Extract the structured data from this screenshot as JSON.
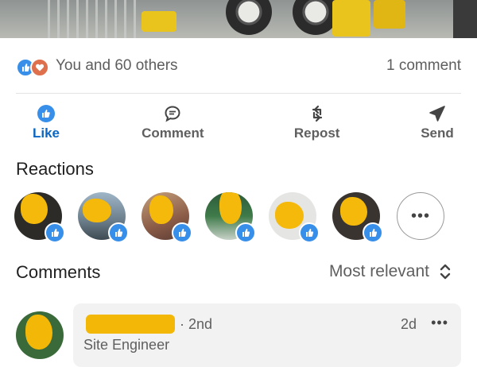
{
  "post": {
    "reaction_summary": "You and 60 others",
    "comment_count": "1 comment",
    "reaction_icons": [
      "like-icon",
      "love-icon"
    ]
  },
  "actions": [
    {
      "label": "Like",
      "icon": "thumbs-up-icon",
      "active": true
    },
    {
      "label": "Comment",
      "icon": "comment-bubble-icon",
      "active": false
    },
    {
      "label": "Repost",
      "icon": "repost-icon",
      "active": false
    },
    {
      "label": "Send",
      "icon": "send-icon",
      "active": false
    }
  ],
  "reactions": {
    "title": "Reactions",
    "more_label": "•••"
  },
  "comments": {
    "title": "Comments",
    "sort_label": "Most relevant",
    "items": [
      {
        "degree": "· 2nd",
        "headline": "Site Engineer",
        "time": "2d",
        "menu": "•••"
      }
    ]
  },
  "colors": {
    "brand_blue": "#0a66c2",
    "like_blue": "#378fe9",
    "love_orange": "#df704d",
    "redaction_yellow": "#f3b807"
  }
}
